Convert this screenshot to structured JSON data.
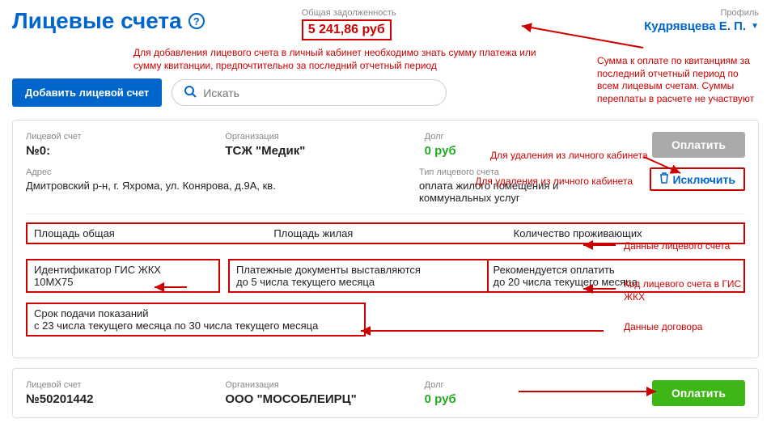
{
  "header": {
    "title": "Лицевые счета",
    "help": "?",
    "debt_label": "Общая задолженность",
    "debt_value": "5 241,86 руб",
    "profile_label": "Профиль",
    "profile_name": "Кудрявцева Е. П."
  },
  "annotations": {
    "add_note": "Для добавления лицевого счета в личный кабинет необходимо знать сумму платежа или сумму квитанции, предпочтительно за последний отчетный период",
    "debt_note": "Сумма к оплате по квитанциям за последний отчетный период по всем лицевым счетам. Суммы переплаты в расчете не участвуют",
    "delete_note": "Для удаления из личного кабинета",
    "data_note": "Данные лицевого счета",
    "gis_note": "Код лицевого счета в ГИС ЖКХ",
    "contract_note": "Данные договора"
  },
  "toolbar": {
    "add_button": "Добавить лицевой счет",
    "search_placeholder": "Искать"
  },
  "card1": {
    "account_label": "Лицевой счет",
    "account_value": "№0:",
    "org_label": "Организация",
    "org_value": "ТСЖ \"Медик\"",
    "debt_label": "Долг",
    "debt_value": "0 руб",
    "pay_button": "Оплатить",
    "address_label": "Адрес",
    "address_value": "Дмитровский р-н, г. Яхрома, ул. Конярова, д.9А, кв.",
    "type_label": "Тип лицевого счета",
    "type_value": "оплата жилого помещения и коммунальных услуг",
    "exclude_button": "Исключить",
    "area_total_label": "Площадь общая",
    "area_living_label": "Площадь жилая",
    "residents_label": "Количество проживающих",
    "gis_label": "Идентификатор ГИС ЖКХ",
    "gis_value": "10МХ75",
    "docs_label": "Платежные документы выставляются",
    "docs_value": "до 5 числа текущего месяца",
    "rec_label": "Рекомендуется оплатить",
    "rec_value": "до 20 числа текущего месяца",
    "readings_label": "Срок подачи показаний",
    "readings_value": "с 23 числа текущего месяца по 30 числа текущего месяца"
  },
  "card2": {
    "account_label": "Лицевой счет",
    "account_value": "№50201442",
    "org_label": "Организация",
    "org_value": "ООО \"МОСОБЛЕИРЦ\"",
    "debt_label": "Долг",
    "debt_value": "0 руб",
    "pay_button": "Оплатить"
  }
}
